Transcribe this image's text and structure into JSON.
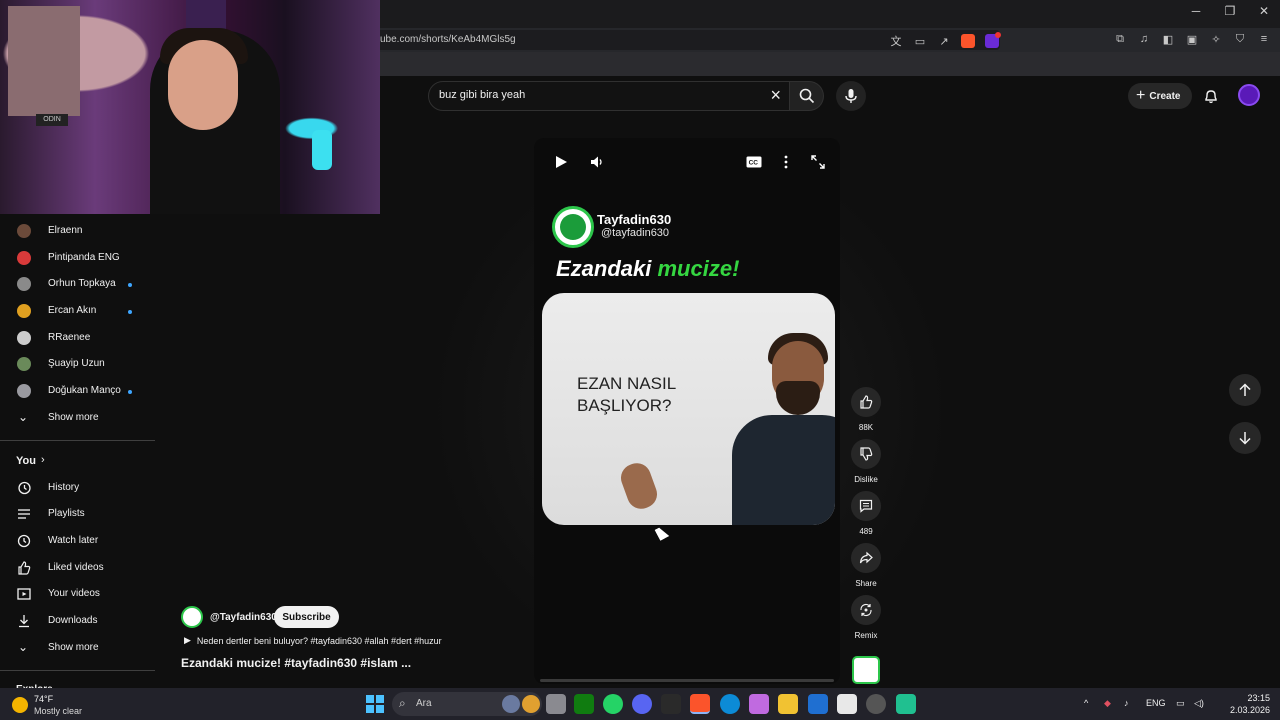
{
  "browser": {
    "url": "ube.com/shorts/KeAb4MGls5g"
  },
  "header": {
    "search_query": "buz gibi bira yeah",
    "create_label": "Create"
  },
  "webcam": {
    "sign_text": "ODIN"
  },
  "sidebar": {
    "subscriptions": [
      {
        "name": "Elraenn",
        "color": "#6b4a3a",
        "new": false
      },
      {
        "name": "Pintipanda ENG",
        "color": "#d93a3a",
        "new": false
      },
      {
        "name": "Orhun Topkaya",
        "color": "#8a8a8a",
        "new": true
      },
      {
        "name": "Ercan Akın",
        "color": "#e0a020",
        "new": true
      },
      {
        "name": "RRaenee",
        "color": "#cccccc",
        "new": false
      },
      {
        "name": "Şuayip Uzun",
        "color": "#6a8a5a",
        "new": false
      },
      {
        "name": "Doğukan Manço",
        "color": "#9a9aa0",
        "new": true
      }
    ],
    "show_more_1": "Show more",
    "you_title": "You",
    "you_items": [
      {
        "label": "History",
        "icon": "history-icon"
      },
      {
        "label": "Playlists",
        "icon": "playlists-icon"
      },
      {
        "label": "Watch later",
        "icon": "watch-later-icon"
      },
      {
        "label": "Liked videos",
        "icon": "like-icon"
      },
      {
        "label": "Your videos",
        "icon": "your-videos-icon"
      },
      {
        "label": "Downloads",
        "icon": "download-icon"
      }
    ],
    "show_more_2": "Show more",
    "explore_title": "Explore"
  },
  "video": {
    "channel_name": "Tayfadin630",
    "channel_handle": "@tayfadin630",
    "title_part1": "Ezandaki",
    "title_part2": "mucize!",
    "card_question": "EZAN NASIL\nBAŞLIYOR?",
    "accent_color": "#35d641"
  },
  "actions": {
    "likes": "88K",
    "dislike_label": "Dislike",
    "comments": "489",
    "share_label": "Share",
    "remix_label": "Remix"
  },
  "info": {
    "handle": "@Tayfadin630",
    "subscribe_label": "Subscribe",
    "song": "Neden dertler beni buluyor? #tayfadin630 #allah #dert #huzur",
    "title": "Ezandaki mucize!  #tayfadin630 #islam ..."
  },
  "taskbar": {
    "temp": "74°F",
    "weather": "Mostly clear",
    "search_placeholder": "Ara",
    "lang": "ENG",
    "time": "23:15",
    "date": "2.03.2026"
  }
}
